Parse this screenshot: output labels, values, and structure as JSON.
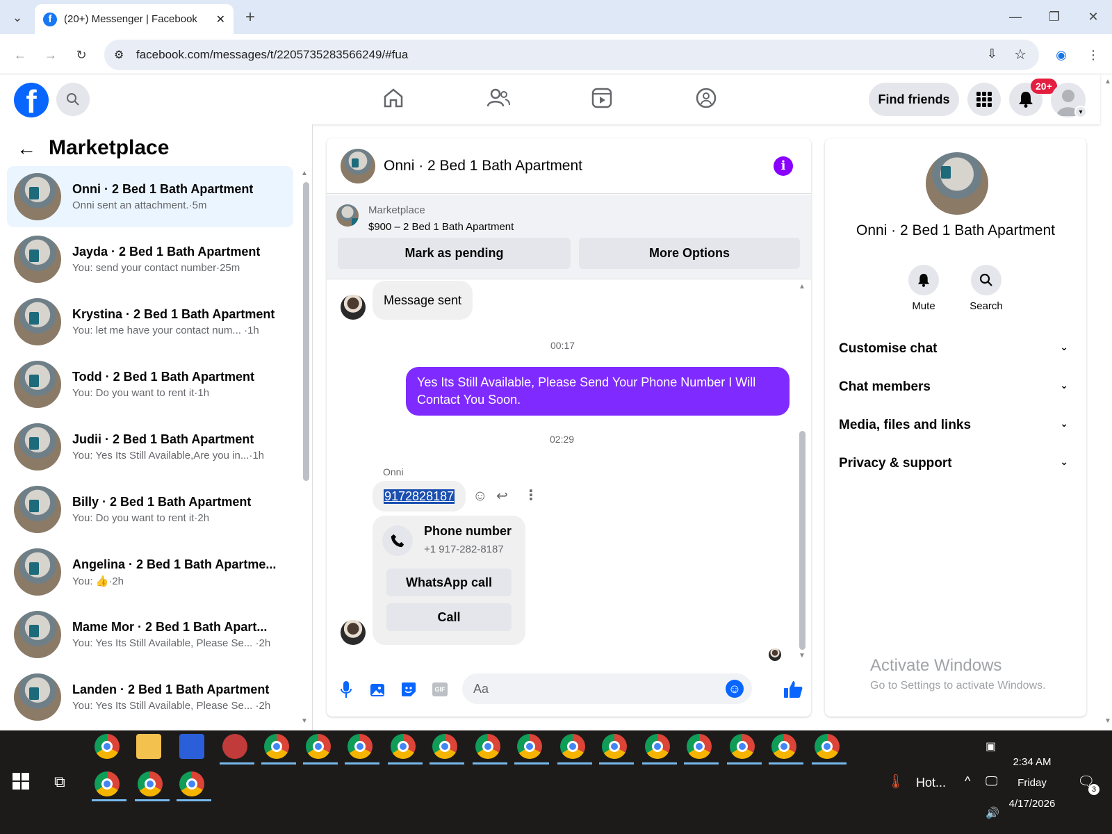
{
  "browser": {
    "tab_title": "(20+) Messenger | Facebook",
    "url": "facebook.com/messages/t/2205735283566249/#fua"
  },
  "fb": {
    "find_friends": "Find friends",
    "notif_badge": "20+"
  },
  "left": {
    "title": "Marketplace",
    "conversations": [
      {
        "name": "Onni · 2 Bed 1 Bath Apartment",
        "sub": "Onni sent an attachment.·5m"
      },
      {
        "name": "Jayda · 2 Bed 1 Bath Apartment",
        "sub": "You: send your contact number·25m"
      },
      {
        "name": "Krystina · 2 Bed 1 Bath Apartment",
        "sub": "You: let me have your contact num... ·1h"
      },
      {
        "name": "Todd · 2 Bed 1 Bath Apartment",
        "sub": "You: Do you want to rent it·1h"
      },
      {
        "name": "Judii · 2 Bed 1 Bath Apartment",
        "sub": "You: Yes Its Still Available,Are you in...·1h"
      },
      {
        "name": "Billy · 2 Bed 1 Bath Apartment",
        "sub": "You: Do you want to rent it·2h"
      },
      {
        "name": "Angelina · 2 Bed 1 Bath Apartme...",
        "sub": "You: 👍·2h"
      },
      {
        "name": "Mame Mor · 2 Bed 1 Bath Apart...",
        "sub": "You: Yes Its Still Available, Please Se... ·2h"
      },
      {
        "name": "Landen · 2 Bed 1 Bath Apartment",
        "sub": "You: Yes Its Still Available, Please Se... ·2h"
      }
    ]
  },
  "chat": {
    "title": "Onni · 2 Bed 1 Bath Apartment",
    "mp_label": "Marketplace",
    "mp_listing": "$900 – 2 Bed 1 Bath Apartment",
    "mark_pending": "Mark as pending",
    "more_options": "More Options",
    "msg_sent": "Message sent",
    "time1": "00:17",
    "outgoing": "Yes Its Still Available, Please Send Your Phone Number I Will Contact You Soon.",
    "time2": "02:29",
    "sender": "Onni",
    "phone_msg": "9172828187",
    "card_title": "Phone number",
    "card_number": "+1 917-282-8187",
    "whatsapp": "WhatsApp call",
    "call": "Call",
    "composer_placeholder": "Aa",
    "gif": "GIF"
  },
  "right": {
    "name": "Onni · 2 Bed 1 Bath Apartment",
    "mute": "Mute",
    "search": "Search",
    "sections": [
      "Customise chat",
      "Chat members",
      "Media, files and links",
      "Privacy & support"
    ],
    "watermark_title": "Activate Windows",
    "watermark_sub": "Go to Settings to activate Windows."
  },
  "taskbar": {
    "weather": "Hot...",
    "time": "2:34 AM",
    "day": "Friday",
    "date": "4/17/2026",
    "notif_count": "3"
  }
}
